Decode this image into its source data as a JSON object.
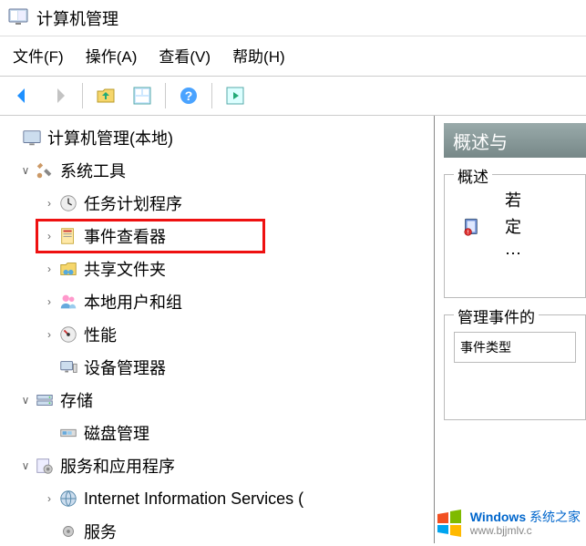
{
  "window": {
    "title": "计算机管理"
  },
  "menu": {
    "file": "文件(F)",
    "action": "操作(A)",
    "view": "查看(V)",
    "help": "帮助(H)"
  },
  "tree": {
    "root": "计算机管理(本地)",
    "sys_tools": "系统工具",
    "task_sched": "任务计划程序",
    "event_viewer": "事件查看器",
    "shared": "共享文件夹",
    "local_users": "本地用户和组",
    "perf": "性能",
    "dev_mgr": "设备管理器",
    "storage": "存储",
    "disk_mgmt": "磁盘管理",
    "services_apps": "服务和应用程序",
    "iis": "Internet Information Services (",
    "services": "服务"
  },
  "right": {
    "header": "概述与",
    "overview_title": "概述",
    "overview_text1": "若",
    "overview_text2": "定",
    "manage_title": "管理事件的",
    "event_type": "事件类型"
  },
  "watermark": {
    "brand": "Windows",
    "slogan": "系统之家",
    "url": "www.bjjmlv.c"
  }
}
